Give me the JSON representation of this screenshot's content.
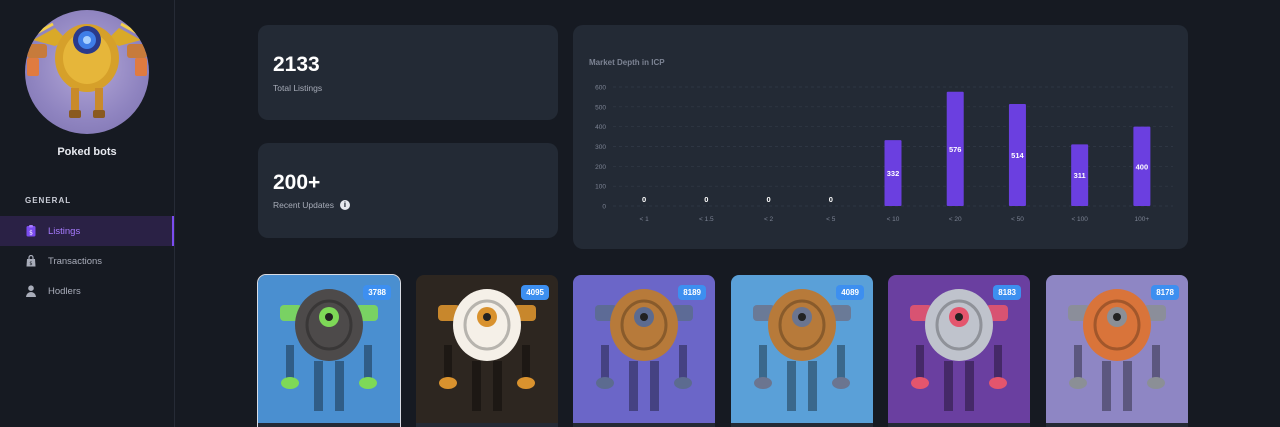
{
  "sidebar": {
    "collection_name": "Poked bots",
    "section_label": "GENERAL",
    "items": [
      {
        "label": "Listings",
        "icon": "listing-icon",
        "active": true
      },
      {
        "label": "Transactions",
        "icon": "bag-icon",
        "active": false
      },
      {
        "label": "Hodlers",
        "icon": "user-icon",
        "active": false
      }
    ]
  },
  "stats": {
    "total_listings": {
      "value": "2133",
      "label": "Total Listings"
    },
    "recent_updates": {
      "value": "200+",
      "label": "Recent Updates",
      "icon": "info-icon"
    }
  },
  "chart_data": {
    "type": "bar",
    "title": "Market Depth in ICP",
    "categories": [
      "< 1",
      "< 1.5",
      "< 2",
      "< 5",
      "< 10",
      "< 20",
      "< 50",
      "< 100",
      "100+"
    ],
    "values": [
      0,
      0,
      0,
      0,
      332,
      576,
      514,
      311,
      400
    ],
    "yticks": [
      0,
      100,
      200,
      300,
      400,
      500,
      600
    ],
    "ylim": [
      0,
      600
    ],
    "bar_color": "#6b3fe0",
    "grid": true
  },
  "nfts": [
    {
      "id": "3788",
      "bg": "#4a8fd0",
      "body": "#4d4a4a",
      "accent": "#7ed957"
    },
    {
      "id": "4095",
      "bg": "#2d2620",
      "body": "#f5f0e8",
      "accent": "#d9922e"
    },
    {
      "id": "8189",
      "bg": "#6b66c8",
      "body": "#b77a3a",
      "accent": "#5c6b90"
    },
    {
      "id": "4089",
      "bg": "#5aa0d8",
      "body": "#b77a3a",
      "accent": "#6b7590"
    },
    {
      "id": "8183",
      "bg": "#6a3fa0",
      "body": "#bfc3cc",
      "accent": "#e4556d"
    },
    {
      "id": "8178",
      "bg": "#8e86c4",
      "body": "#d9743a",
      "accent": "#8b8f96"
    }
  ]
}
